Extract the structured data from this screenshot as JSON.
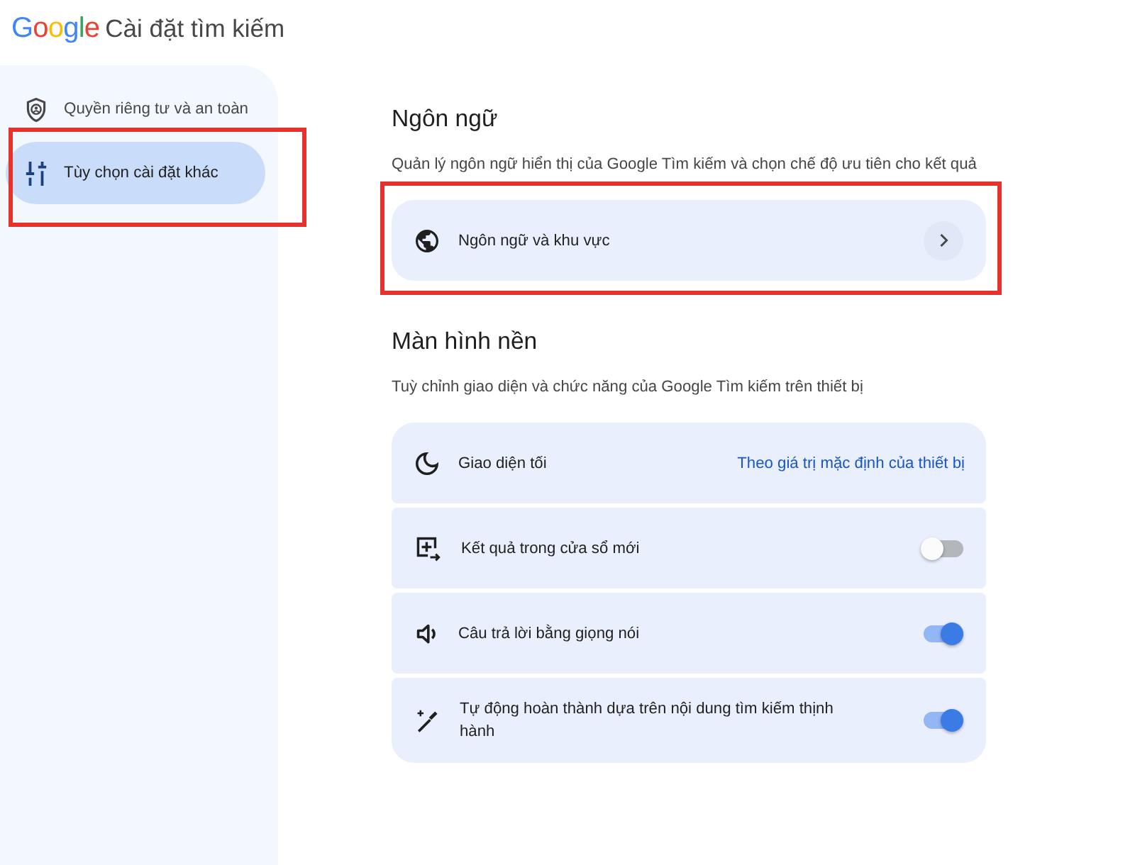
{
  "header": {
    "logo": "Google",
    "title": "Cài đặt tìm kiếm"
  },
  "sidebar": {
    "items": [
      {
        "label": "Quyền riêng tư và an toàn",
        "selected": false,
        "annotated": false
      },
      {
        "label": "Tùy chọn cài đặt khác",
        "selected": true,
        "annotated": true
      }
    ]
  },
  "sections": [
    {
      "title": "Ngôn ngữ",
      "description": "Quản lý ngôn ngữ hiển thị của Google Tìm kiếm và chọn chế độ ưu tiên cho kết quả",
      "rows": [
        {
          "kind": "link",
          "label": "Ngôn ngữ và khu vực",
          "annotated": true
        }
      ]
    },
    {
      "title": "Màn hình nền",
      "description": "Tuỳ chỉnh giao diện và chức năng của Google Tìm kiếm trên thiết bị",
      "rows": [
        {
          "kind": "value",
          "label": "Giao diện tối",
          "value": "Theo giá trị mặc định của thiết bị",
          "annotated": false
        },
        {
          "kind": "toggle",
          "label": "Kết quả trong cửa sổ mới",
          "on": false,
          "annotated": false
        },
        {
          "kind": "toggle",
          "label": "Câu trả lời bằng giọng nói",
          "on": true,
          "annotated": false
        },
        {
          "kind": "toggle",
          "label": "Tự động hoàn thành dựa trên nội dung tìm kiếm thịnh hành",
          "on": true,
          "annotated": false
        }
      ]
    }
  ]
}
